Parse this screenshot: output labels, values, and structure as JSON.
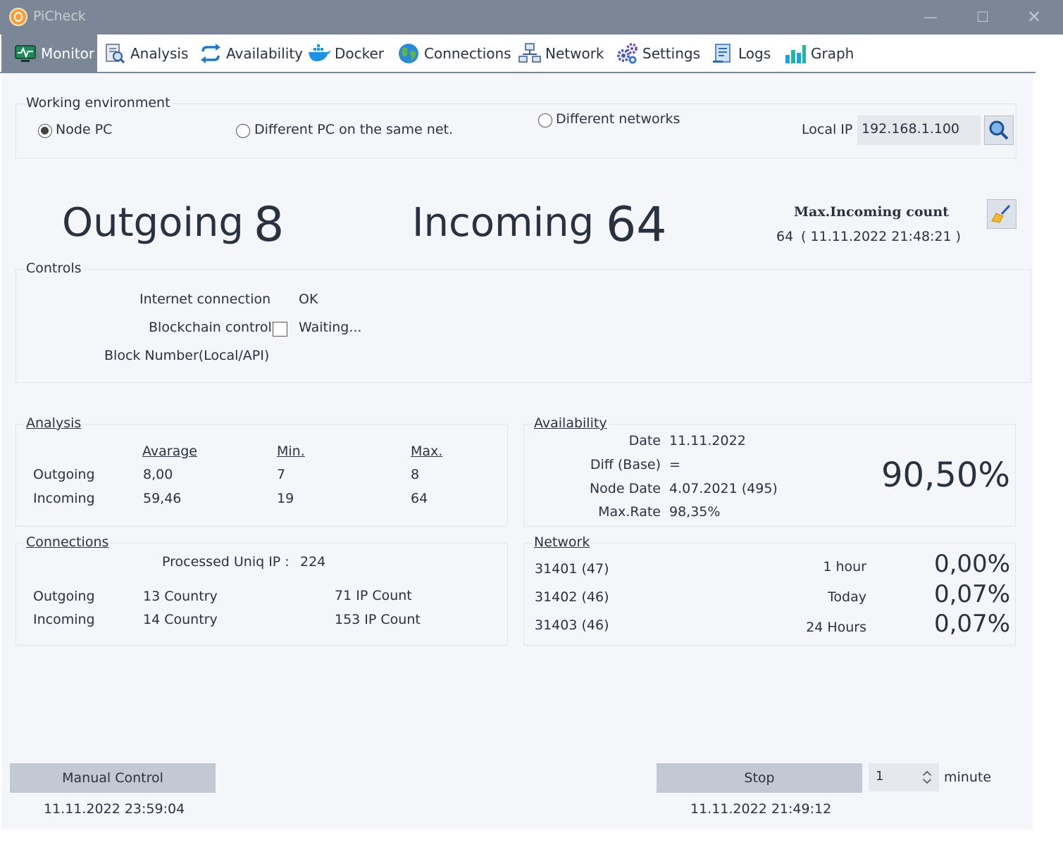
{
  "window": {
    "title": "PiCheck"
  },
  "tabs": [
    {
      "label": "Monitor",
      "icon": "monitor-icon",
      "active": true
    },
    {
      "label": "Analysis",
      "icon": "document-search-icon"
    },
    {
      "label": "Availability",
      "icon": "refresh-arrows-icon"
    },
    {
      "label": "Docker",
      "icon": "docker-whale-icon"
    },
    {
      "label": "Connections",
      "icon": "globe-icon"
    },
    {
      "label": "Network",
      "icon": "network-icon"
    },
    {
      "label": "Settings",
      "icon": "gears-icon"
    },
    {
      "label": "Logs",
      "icon": "log-file-icon"
    },
    {
      "label": "Graph",
      "icon": "bar-graph-icon"
    }
  ],
  "working_env": {
    "title": "Working environment",
    "options": [
      "Node PC",
      "Different PC on the same net.",
      "Different networks"
    ],
    "selected": "Node PC",
    "local_ip_label": "Local IP",
    "local_ip": "192.168.1.100"
  },
  "counts": {
    "outgoing_label": "Outgoing",
    "outgoing": "8",
    "incoming_label": "Incoming",
    "incoming": "64",
    "max_incoming_title": "Max.Incoming count",
    "max_incoming_value": "64",
    "max_incoming_time": "( 11.11.2022 21:48:21 )"
  },
  "controls": {
    "title": "Controls",
    "internet_label": "Internet connection",
    "internet_status": "OK",
    "blockchain_label": "Blockchain control",
    "blockchain_status": "Waiting...",
    "block_number_label": "Block Number(Local/API)"
  },
  "analysis": {
    "title": "Analysis",
    "headers": [
      "Avarage",
      "Min.",
      "Max."
    ],
    "rows": [
      {
        "label": "Outgoing",
        "avg": "8,00",
        "min": "7",
        "max": "8"
      },
      {
        "label": "Incoming",
        "avg": "59,46",
        "min": "19",
        "max": "64"
      }
    ]
  },
  "availability": {
    "title": "Availability",
    "date_label": "Date",
    "date": "11.11.2022",
    "diff_label": "Diff (Base)",
    "diff": "=",
    "node_date_label": "Node Date",
    "node_date": "4.07.2021 (495)",
    "max_rate_label": "Max.Rate",
    "max_rate": "98,35%",
    "percent": "90,50%"
  },
  "connections": {
    "title": "Connections",
    "processed_label": "Processed Uniq IP :",
    "processed": "224",
    "rows": [
      {
        "label": "Outgoing",
        "country": "13 Country",
        "ip": "71 IP Count"
      },
      {
        "label": "Incoming",
        "country": "14 Country",
        "ip": "153 IP Count"
      }
    ]
  },
  "network": {
    "title": "Network",
    "ports": [
      "31401 (47)",
      "31402 (46)",
      "31403 (46)"
    ],
    "periods": [
      {
        "label": "1 hour",
        "value": "0,00%"
      },
      {
        "label": "Today",
        "value": "0,07%"
      },
      {
        "label": "24 Hours",
        "value": "0,07%"
      }
    ]
  },
  "footer": {
    "manual_button": "Manual Control",
    "manual_time": "11.11.2022 23:59:04",
    "stop_button": "Stop",
    "interval_value": "1",
    "interval_unit": "minute",
    "stop_time": "11.11.2022 21:49:12"
  },
  "colors": {
    "titlebar": "#7b8696",
    "content_bg": "#f5f6fa",
    "button": "#c3c9d3",
    "text": "#2a3140"
  }
}
